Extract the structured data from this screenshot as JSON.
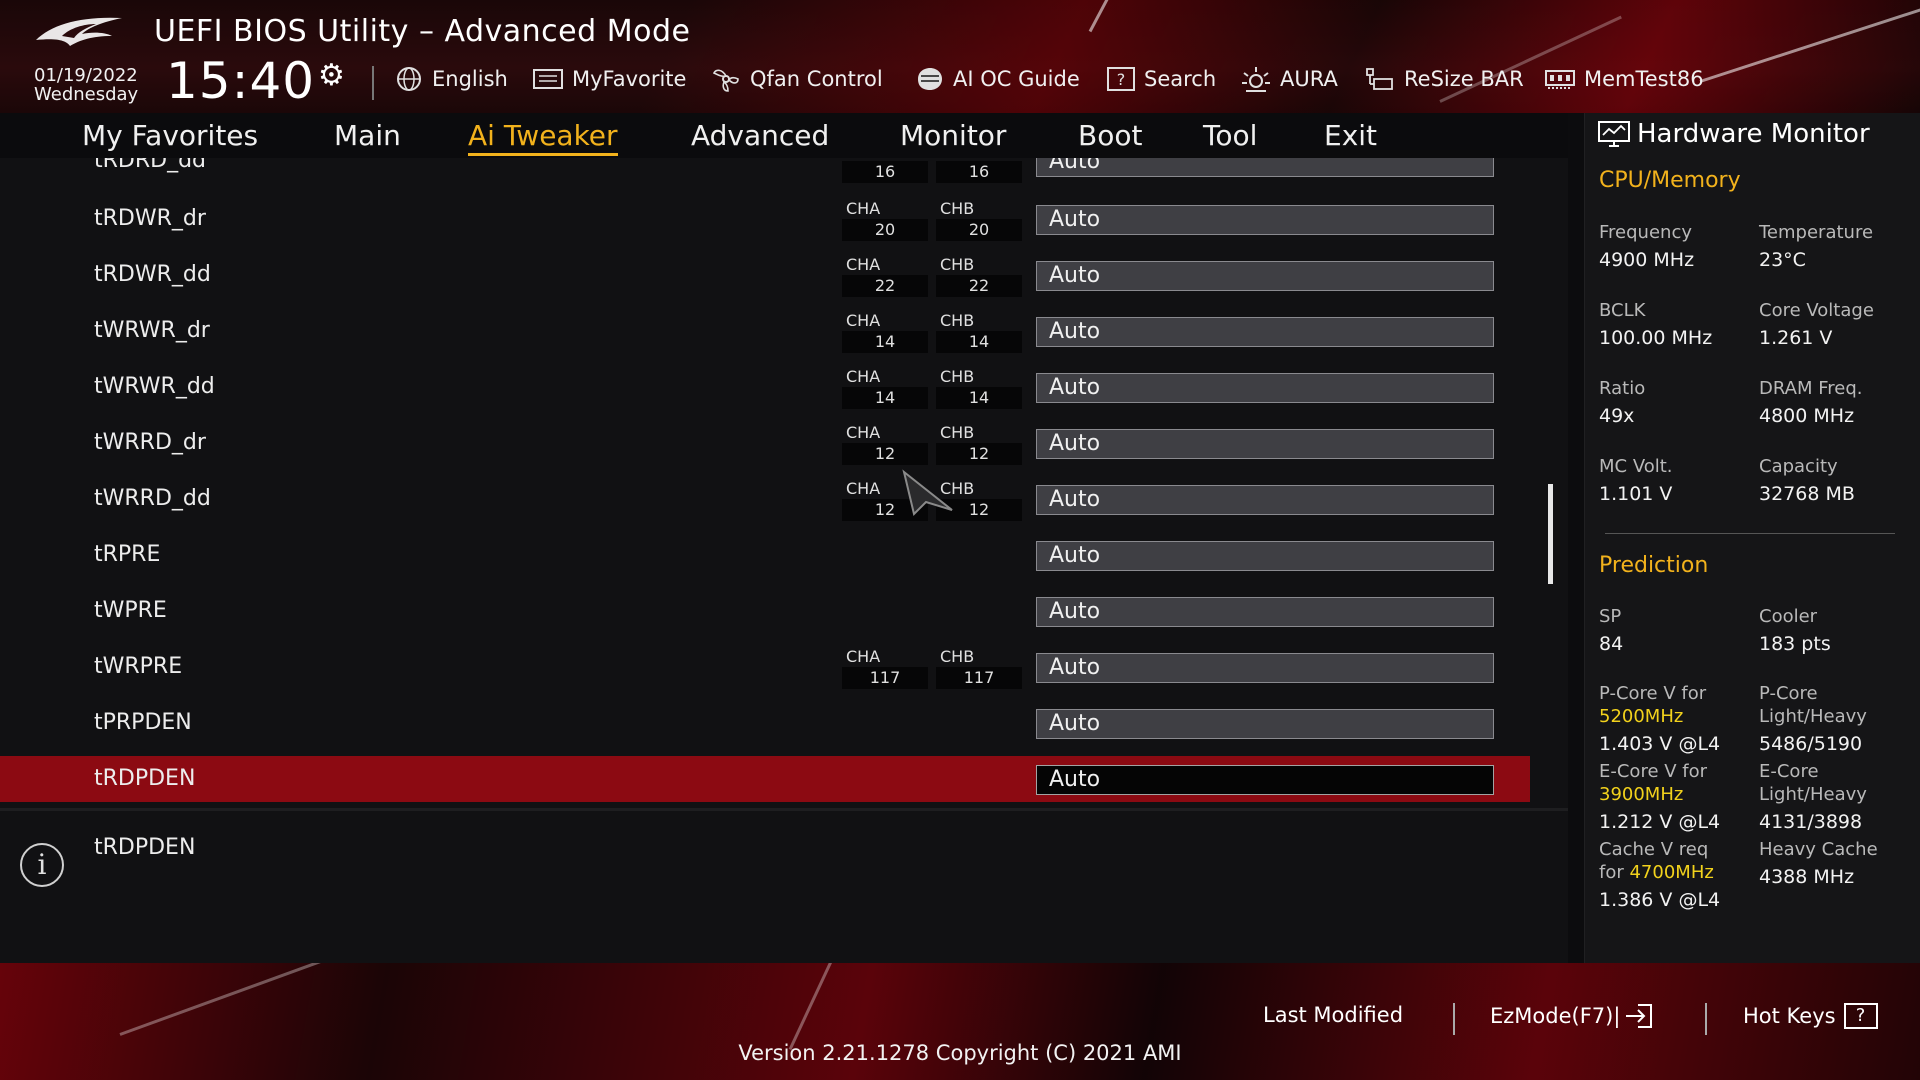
{
  "header": {
    "title": "UEFI BIOS Utility – Advanced Mode",
    "date": "01/19/2022",
    "weekday": "Wednesday",
    "time": "15:40",
    "toolbar": {
      "english": "English",
      "myfavorite": "MyFavorite",
      "qfan": "Qfan Control",
      "aioc": "AI OC Guide",
      "search": "Search",
      "aura": "AURA",
      "resizebar": "ReSize BAR",
      "memtest": "MemTest86"
    }
  },
  "nav": {
    "tabs": [
      "My Favorites",
      "Main",
      "Ai Tweaker",
      "Advanced",
      "Monitor",
      "Boot",
      "Tool",
      "Exit"
    ],
    "active": "Ai Tweaker"
  },
  "settings": {
    "rows": [
      {
        "label": "tRDRD_dd",
        "cha_label": "",
        "cha": "16",
        "chb_label": "",
        "chb": "16",
        "value": "Auto"
      },
      {
        "label": "tRDWR_dr",
        "cha_label": "CHA",
        "cha": "20",
        "chb_label": "CHB",
        "chb": "20",
        "value": "Auto"
      },
      {
        "label": "tRDWR_dd",
        "cha_label": "CHA",
        "cha": "22",
        "chb_label": "CHB",
        "chb": "22",
        "value": "Auto"
      },
      {
        "label": "tWRWR_dr",
        "cha_label": "CHA",
        "cha": "14",
        "chb_label": "CHB",
        "chb": "14",
        "value": "Auto"
      },
      {
        "label": "tWRWR_dd",
        "cha_label": "CHA",
        "cha": "14",
        "chb_label": "CHB",
        "chb": "14",
        "value": "Auto"
      },
      {
        "label": "tWRRD_dr",
        "cha_label": "CHA",
        "cha": "12",
        "chb_label": "CHB",
        "chb": "12",
        "value": "Auto"
      },
      {
        "label": "tWRRD_dd",
        "cha_label": "CHA",
        "cha": "12",
        "chb_label": "CHB",
        "chb": "12",
        "value": "Auto"
      },
      {
        "label": "tRPRE",
        "value": "Auto"
      },
      {
        "label": "tWPRE",
        "value": "Auto"
      },
      {
        "label": "tWRPRE",
        "cha_label": "CHA",
        "cha": "117",
        "chb_label": "CHB",
        "chb": "117",
        "value": "Auto"
      },
      {
        "label": "tPRPDEN",
        "value": "Auto"
      },
      {
        "label": "tRDPDEN",
        "value": "Auto"
      }
    ],
    "selected_row": "tRDPDEN",
    "info_text": "tRDPDEN"
  },
  "hardware_monitor": {
    "title": "Hardware Monitor",
    "cpu_memory": {
      "heading": "CPU/Memory",
      "frequency_label": "Frequency",
      "frequency": "4900 MHz",
      "temperature_label": "Temperature",
      "temperature": "23°C",
      "bclk_label": "BCLK",
      "bclk": "100.00 MHz",
      "core_voltage_label": "Core Voltage",
      "core_voltage": "1.261 V",
      "ratio_label": "Ratio",
      "ratio": "49x",
      "dram_freq_label": "DRAM Freq.",
      "dram_freq": "4800 MHz",
      "mc_volt_label": "MC Volt.",
      "mc_volt": "1.101 V",
      "capacity_label": "Capacity",
      "capacity": "32768 MB"
    },
    "prediction": {
      "heading": "Prediction",
      "sp_label": "SP",
      "sp": "84",
      "cooler_label": "Cooler",
      "cooler": "183 pts",
      "pcore_v_label": "P-Core V for",
      "pcore_v_freq": "5200MHz",
      "pcore_v": "1.403 V @L4",
      "pcore_lh_label": "P-Core Light/Heavy",
      "pcore_lh": "5486/5190",
      "ecore_v_label": "E-Core V for",
      "ecore_v_freq": "3900MHz",
      "ecore_v": "1.212 V @L4",
      "ecore_lh_label": "E-Core Light/Heavy",
      "ecore_lh": "4131/3898",
      "cache_v_label": "Cache V req",
      "cache_v_for": "for",
      "cache_v_freq": "4700MHz",
      "cache_v": "1.386 V @L4",
      "heavy_cache_label": "Heavy Cache",
      "heavy_cache": "4388 MHz"
    }
  },
  "footer": {
    "last_modified": "Last Modified",
    "ezmode": "EzMode(F7)|",
    "hot_keys": "Hot Keys",
    "hot_keys_key": "?",
    "version": "Version 2.21.1278 Copyright (C) 2021 AMI"
  },
  "colors": {
    "accent": "#f2b21c",
    "selected_row": "#8c0a12",
    "highlight_freq": "#f2d21c"
  }
}
